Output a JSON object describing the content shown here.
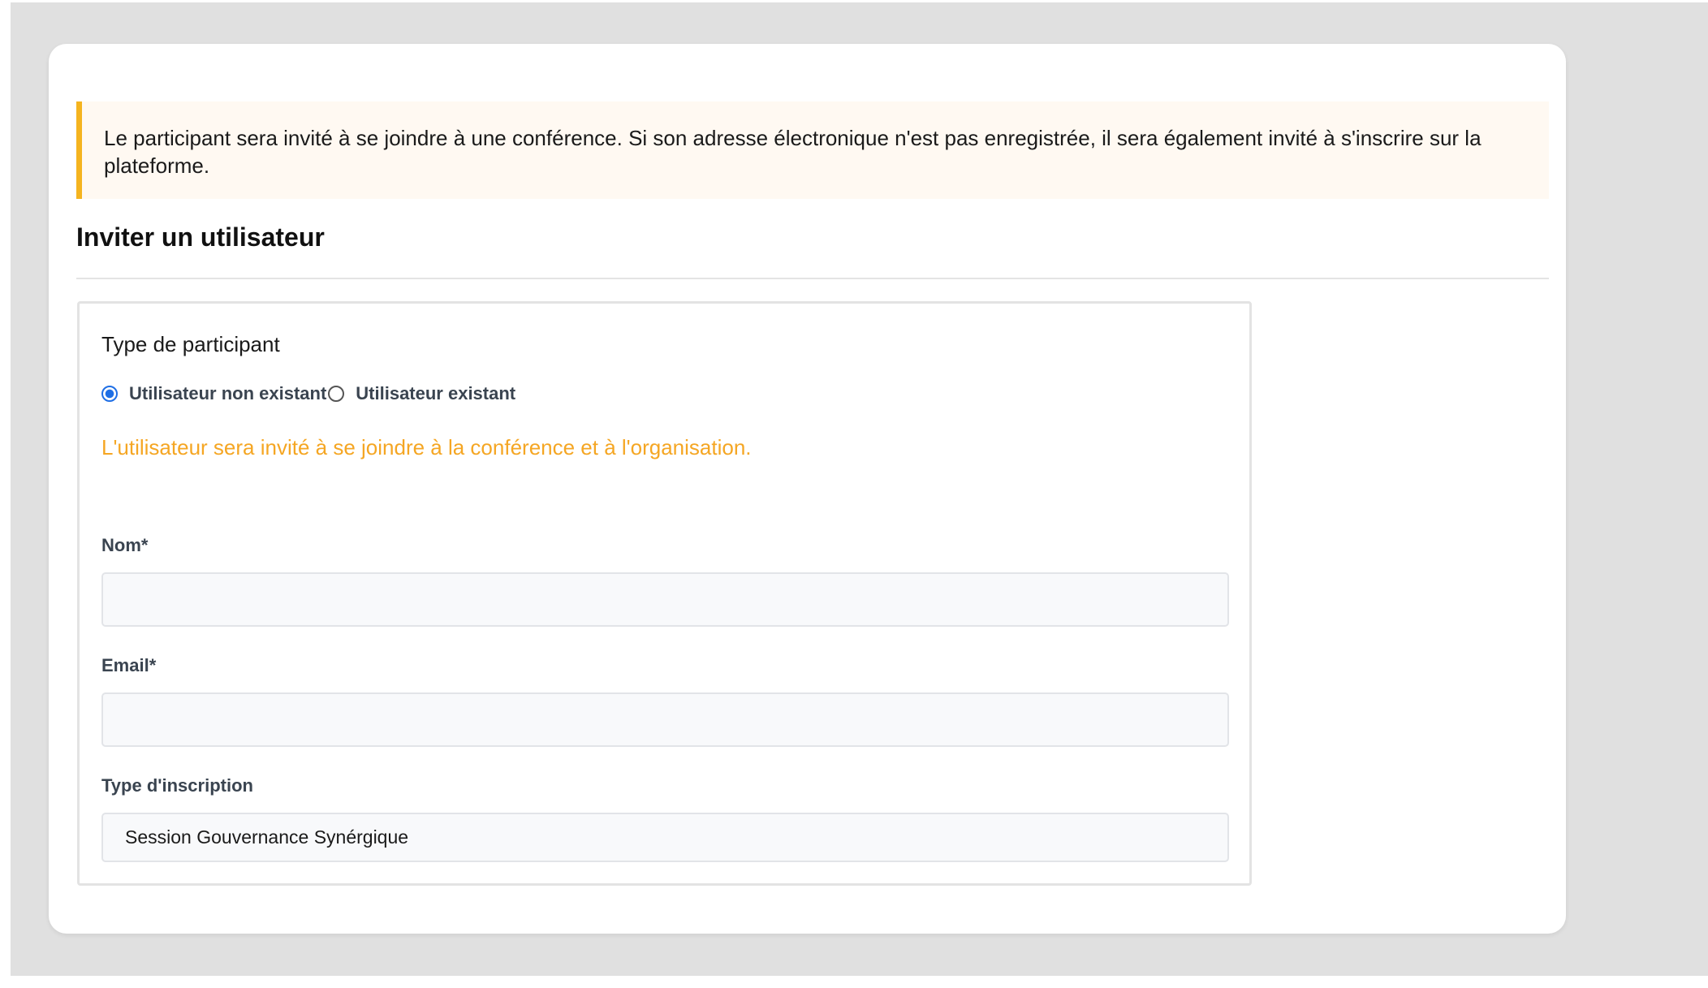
{
  "notice": {
    "text": "Le participant sera invité à se joindre à une conférence. Si son adresse électronique n'est pas enregistrée, il sera également invité à s'inscrire sur la plateforme."
  },
  "heading": "Inviter un utilisateur",
  "participant_type": {
    "legend": "Type de participant",
    "options": [
      {
        "label": "Utilisateur non existant",
        "checked": true
      },
      {
        "label": "Utilisateur existant",
        "checked": false
      }
    ],
    "hint": "L'utilisateur sera invité à se joindre à la conférence et à l'organisation."
  },
  "form": {
    "name_label": "Nom*",
    "name_value": "",
    "email_label": "Email*",
    "email_value": "",
    "registration_label": "Type d'inscription",
    "registration_value": "Session Gouvernance Synérgique"
  },
  "colors": {
    "accent": "#f5b41f",
    "hint": "#f5a623",
    "radio_checked": "#1f6fe5",
    "backdrop": "#e0e0e0"
  }
}
